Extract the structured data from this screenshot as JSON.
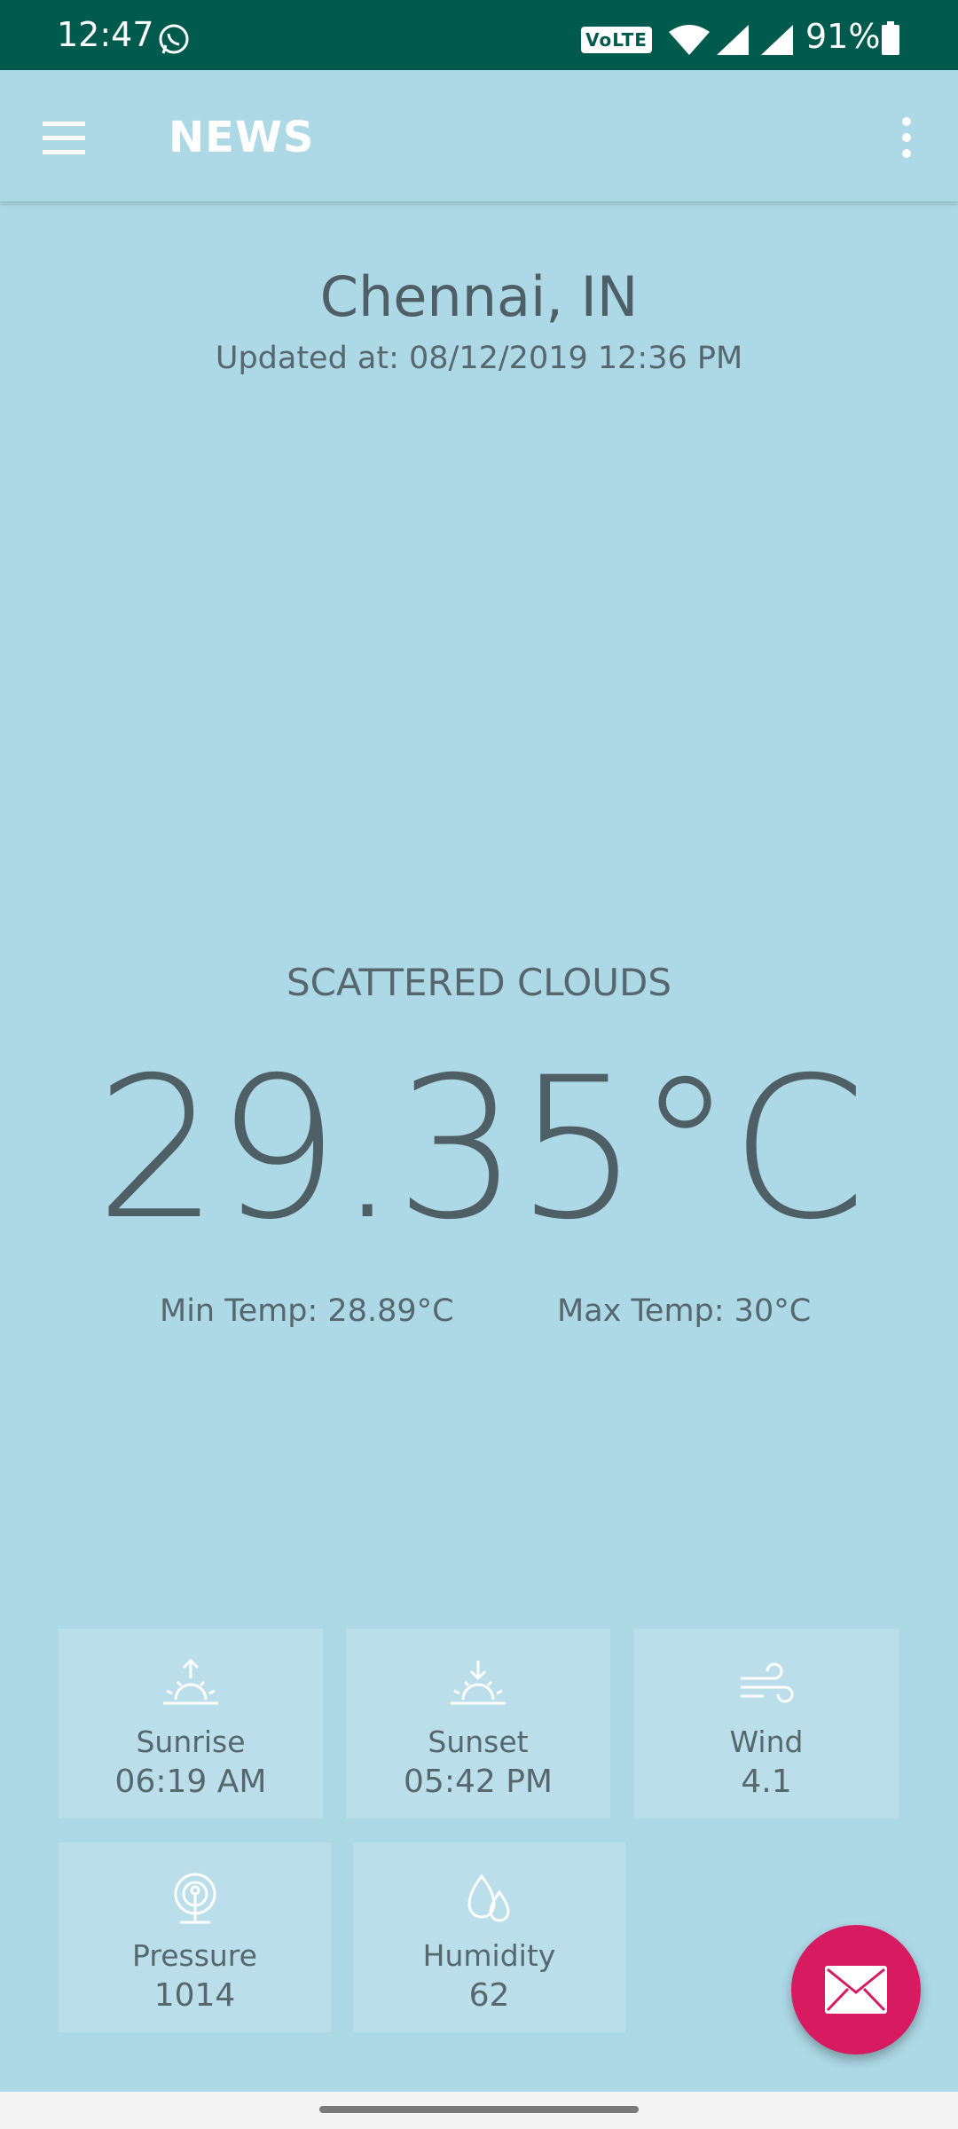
{
  "status_bar": {
    "time": "12:47",
    "volte": "VoLTE",
    "battery": "91%"
  },
  "app_bar": {
    "title": "NEWS"
  },
  "location": {
    "city": "Chennai, IN",
    "updated": "Updated at: 08/12/2019 12:36 PM"
  },
  "weather": {
    "status": "SCATTERED CLOUDS",
    "temperature": "29.35°C",
    "min_temp": "Min Temp: 28.89°C",
    "max_temp": "Max Temp: 30°C"
  },
  "details": [
    {
      "label": "Sunrise",
      "value": "06:19 AM",
      "icon": "sunrise-icon"
    },
    {
      "label": "Sunset",
      "value": "05:42 PM",
      "icon": "sunset-icon"
    },
    {
      "label": "Wind",
      "value": "4.1",
      "icon": "wind-icon"
    },
    {
      "label": "Pressure",
      "value": "1014",
      "icon": "pressure-icon"
    },
    {
      "label": "Humidity",
      "value": "62",
      "icon": "humidity-icon"
    }
  ],
  "colors": {
    "status_bar": "#005a4d",
    "background": "#add8e6",
    "fab": "#d81b60"
  }
}
